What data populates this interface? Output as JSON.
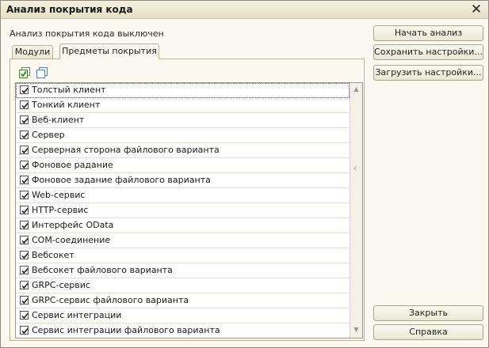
{
  "window": {
    "title": "Анализ покрытия кода",
    "close_glyph": "✕"
  },
  "status": "Анализ покрытия кода выключен",
  "tabs": [
    {
      "label": "Модули",
      "active": false
    },
    {
      "label": "Предметы покрытия",
      "active": true
    }
  ],
  "toolbar": {
    "icons": [
      "check-all-icon",
      "uncheck-all-icon"
    ]
  },
  "list": {
    "items": [
      {
        "label": "Толстый клиент",
        "checked": true
      },
      {
        "label": "Тонкий клиент",
        "checked": true
      },
      {
        "label": "Веб-клиент",
        "checked": true
      },
      {
        "label": "Сервер",
        "checked": true
      },
      {
        "label": "Серверная сторона файлового варианта",
        "checked": true
      },
      {
        "label": "Фоновое радание",
        "checked": true
      },
      {
        "label": "Фоновое задание файлового варианта",
        "checked": true
      },
      {
        "label": "Web-сервис",
        "checked": true
      },
      {
        "label": "HTTP-сервис",
        "checked": true
      },
      {
        "label": "Интерфейс OData",
        "checked": true
      },
      {
        "label": "COM-соединение",
        "checked": true
      },
      {
        "label": "Вебсокет",
        "checked": true
      },
      {
        "label": "Вебсокет файлового варианта",
        "checked": true
      },
      {
        "label": "GRPC-сервис",
        "checked": true
      },
      {
        "label": "GRPC-сервис файлового варианта",
        "checked": true
      },
      {
        "label": "Сервис интеграции",
        "checked": true
      },
      {
        "label": "Сервис интеграции файлового варианта",
        "checked": true
      }
    ]
  },
  "buttons": {
    "start": "Начать анализ",
    "save": "Сохранить настройки...",
    "load": "Загрузить настройки...",
    "close": "Закрыть",
    "help": "Справка"
  },
  "colors": {
    "window_bg": "#fbf9ef",
    "titlebar": "#e9e5cd",
    "check_green": "#3a8a2a"
  }
}
